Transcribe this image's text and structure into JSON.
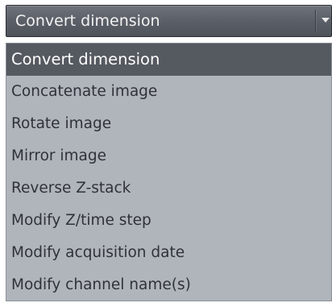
{
  "dropdown": {
    "selected_value": "Convert dimension",
    "options": [
      {
        "label": "Convert dimension",
        "selected": true
      },
      {
        "label": "Concatenate image",
        "selected": false
      },
      {
        "label": "Rotate image",
        "selected": false
      },
      {
        "label": "Mirror image",
        "selected": false
      },
      {
        "label": "Reverse Z-stack",
        "selected": false
      },
      {
        "label": "Modify Z/time step",
        "selected": false
      },
      {
        "label": "Modify acquisition date",
        "selected": false
      },
      {
        "label": "Modify channel name(s)",
        "selected": false
      }
    ]
  },
  "colors": {
    "combo_background": "#5c6068",
    "list_background": "#b0b5bc",
    "selected_background": "#555960",
    "text": "#303238"
  },
  "icons": {
    "expand_arrow": "chevron-down-icon"
  }
}
